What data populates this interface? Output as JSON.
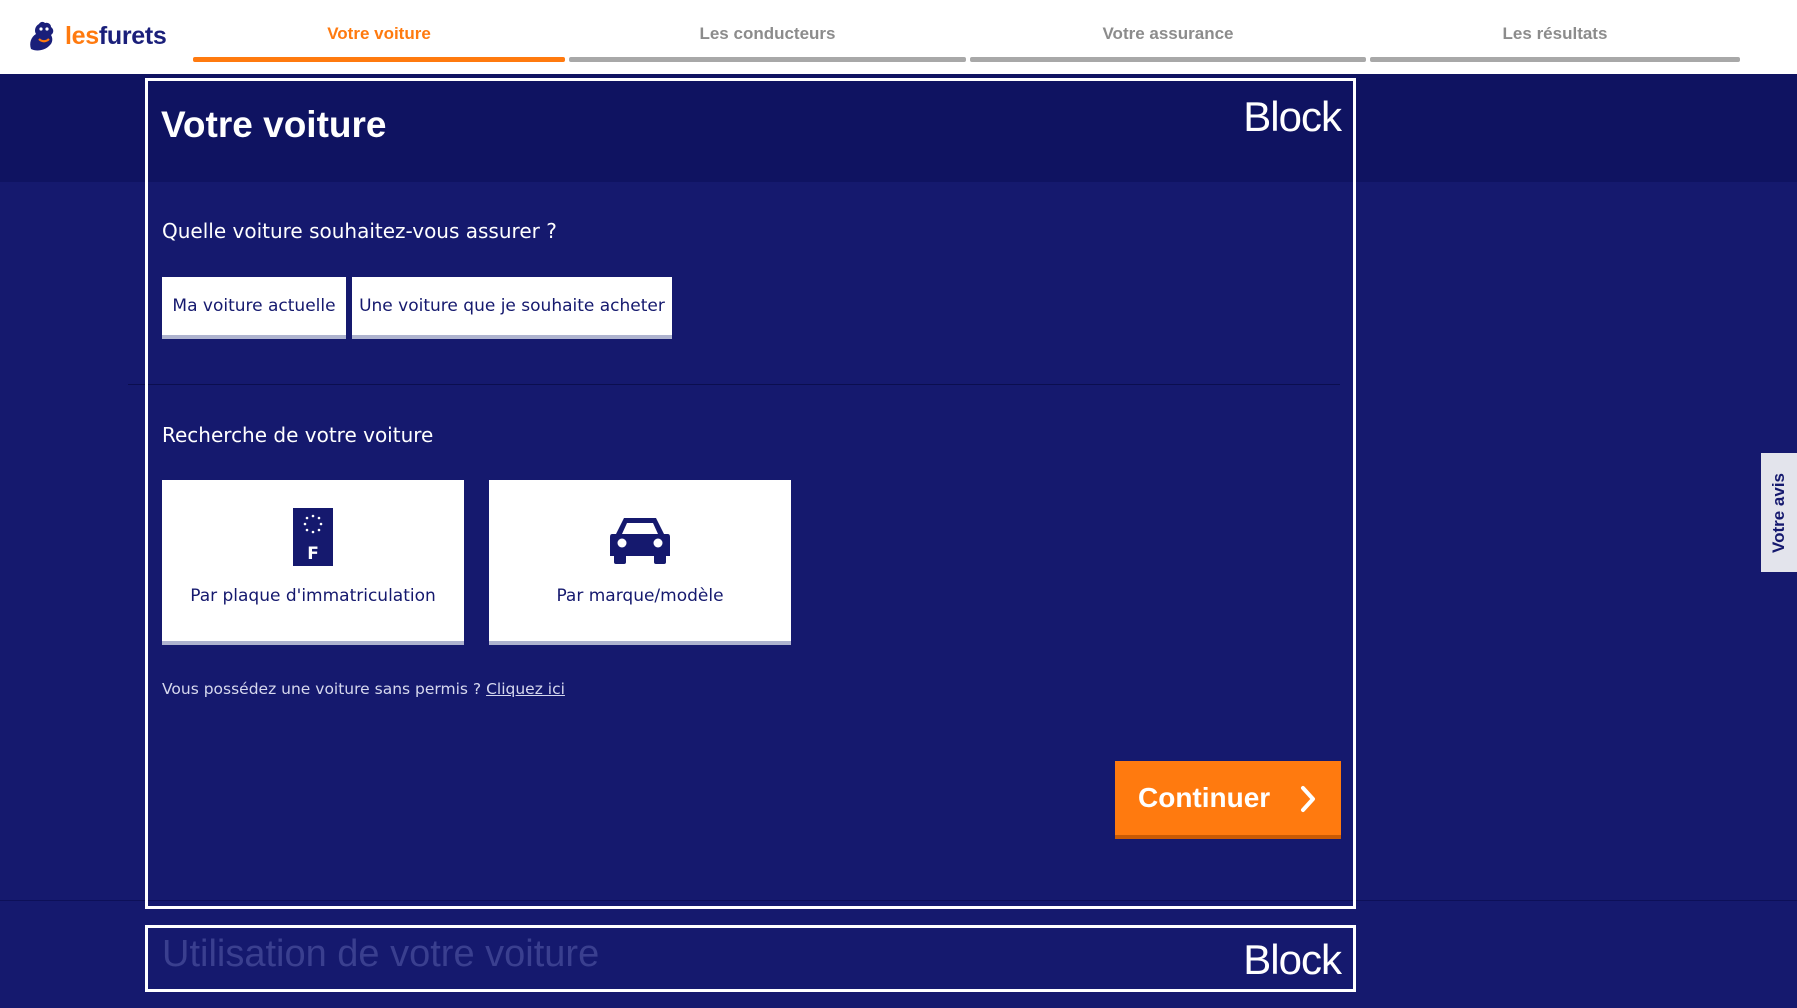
{
  "header": {
    "logo": {
      "les": "les",
      "furets": "furets",
      "icon": "ferret-logo-icon"
    },
    "steps": [
      {
        "label": "Votre voiture",
        "active": true
      },
      {
        "label": "Les conducteurs",
        "active": false
      },
      {
        "label": "Votre assurance",
        "active": false
      },
      {
        "label": "Les résultats",
        "active": false
      }
    ]
  },
  "overlay": {
    "block_label": "Block",
    "block_label_2": "Block"
  },
  "main": {
    "title": "Votre voiture",
    "question_1": "Quelle voiture souhaitez-vous assurer ?",
    "choices": [
      {
        "label": "Ma voiture actuelle"
      },
      {
        "label": "Une voiture que je souhaite acheter"
      }
    ],
    "question_2": "Recherche de votre voiture",
    "search_options": [
      {
        "label": "Par plaque d'immatriculation",
        "icon": "license-plate-icon",
        "plate_letter": "F"
      },
      {
        "label": "Par marque/modèle",
        "icon": "car-icon"
      }
    ],
    "no_license_text": "Vous possédez une voiture sans permis ?",
    "no_license_link": "Cliquez ici",
    "continue_label": "Continuer"
  },
  "next_section": {
    "title": "Utilisation de votre voiture"
  },
  "feedback": {
    "label": "Votre avis"
  },
  "colors": {
    "brand_navy": "#15196e",
    "title_band": "#0f1361",
    "accent_orange": "#ff7a0f",
    "inactive_step": "#a8a8a8"
  }
}
